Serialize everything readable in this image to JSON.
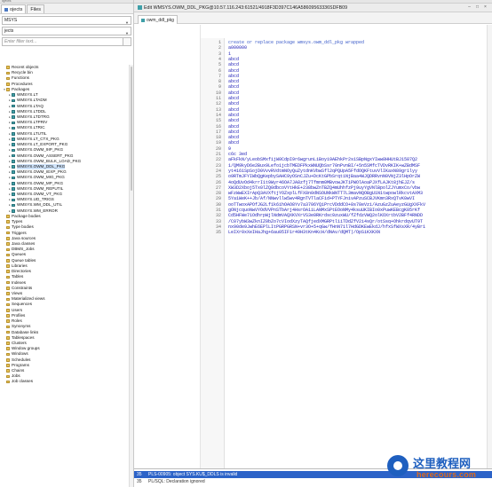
{
  "left_panel": {
    "topbar_text": "ojects",
    "tabs": [
      {
        "label": "ojects",
        "active": true
      },
      {
        "label": "Files",
        "active": false
      }
    ],
    "schema_select": "MSYS",
    "type_select": "jects",
    "filter_placeholder": "Enter filter text...",
    "tree": [
      {
        "label": "Recent objects",
        "kind": "folder",
        "expandable": false
      },
      {
        "label": "Recycle bin",
        "kind": "folder",
        "expandable": false
      },
      {
        "label": "Functions",
        "kind": "folder",
        "expandable": false
      },
      {
        "label": "Procedures",
        "kind": "folder",
        "expandable": false
      },
      {
        "label": "Packages",
        "kind": "folder",
        "expandable": true,
        "expanded": true
      },
      {
        "label": "WMSYS.LT",
        "kind": "pkg",
        "expandable": true
      },
      {
        "label": "WMSYS.LTADM",
        "kind": "pkg",
        "expandable": true
      },
      {
        "label": "WMSYS.LTAQ",
        "kind": "pkg",
        "expandable": true
      },
      {
        "label": "WMSYS.LTDDL",
        "kind": "pkg",
        "expandable": true
      },
      {
        "label": "WMSYS.LTDTRG",
        "kind": "pkg",
        "expandable": true
      },
      {
        "label": "WMSYS.LTPRIV",
        "kind": "pkg",
        "expandable": true
      },
      {
        "label": "WMSYS.LTRIC",
        "kind": "pkg",
        "expandable": true
      },
      {
        "label": "WMSYS.LTUTIL",
        "kind": "pkg",
        "expandable": true
      },
      {
        "label": "WMSYS.LT_CTX_PKG",
        "kind": "pkg",
        "expandable": true
      },
      {
        "label": "WMSYS.LT_EXPORT_PKG",
        "kind": "pkg",
        "expandable": true
      },
      {
        "label": "WMSYS.OWM_9IP_PKG",
        "kind": "pkg",
        "expandable": true
      },
      {
        "label": "WMSYS.OWM_ASSERT_PKG",
        "kind": "pkg",
        "expandable": true
      },
      {
        "label": "WMSYS.OWM_BULK_LOAD_PKG",
        "kind": "pkg",
        "expandable": true
      },
      {
        "label": "WMSYS.OWM_DDL_PKG",
        "kind": "pkg",
        "expandable": true,
        "selected": true
      },
      {
        "label": "WMSYS.OWM_IEXP_PKG",
        "kind": "pkg",
        "expandable": true
      },
      {
        "label": "WMSYS.OWM_MIG_PKG",
        "kind": "pkg",
        "expandable": true
      },
      {
        "label": "WMSYS.OWM_MP_PKG",
        "kind": "pkg",
        "expandable": true
      },
      {
        "label": "WMSYS.OWM_REPUTIL",
        "kind": "pkg",
        "expandable": true
      },
      {
        "label": "WMSYS.OWM_VT_PKG",
        "kind": "pkg",
        "expandable": true
      },
      {
        "label": "WMSYS.UD_TRIGS",
        "kind": "pkg",
        "expandable": true
      },
      {
        "label": "WMSYS.WM_DDL_UTIL",
        "kind": "pkg",
        "expandable": true
      },
      {
        "label": "WMSYS.WM_ERROR",
        "kind": "pkg",
        "expandable": true
      },
      {
        "label": "Package bodies",
        "kind": "folder",
        "expandable": false
      },
      {
        "label": "Types",
        "kind": "folder",
        "expandable": false
      },
      {
        "label": "Type bodies",
        "kind": "folder",
        "expandable": false
      },
      {
        "label": "Triggers",
        "kind": "folder",
        "expandable": false
      },
      {
        "label": "Java sources",
        "kind": "folder",
        "expandable": false
      },
      {
        "label": "Java classes",
        "kind": "folder",
        "expandable": false
      },
      {
        "label": "DBMS_Jobs",
        "kind": "folder",
        "expandable": false
      },
      {
        "label": "Queues",
        "kind": "folder",
        "expandable": false
      },
      {
        "label": "Queue tables",
        "kind": "folder",
        "expandable": false
      },
      {
        "label": "Libraries",
        "kind": "folder",
        "expandable": false
      },
      {
        "label": "Directories",
        "kind": "folder",
        "expandable": false
      },
      {
        "label": "Tables",
        "kind": "folder",
        "expandable": false
      },
      {
        "label": "Indexes",
        "kind": "folder",
        "expandable": false
      },
      {
        "label": "Constraints",
        "kind": "folder",
        "expandable": false
      },
      {
        "label": "Views",
        "kind": "folder",
        "expandable": false
      },
      {
        "label": "Materialized views",
        "kind": "folder",
        "expandable": false
      },
      {
        "label": "Sequences",
        "kind": "folder",
        "expandable": false
      },
      {
        "label": "Users",
        "kind": "folder",
        "expandable": false
      },
      {
        "label": "Profiles",
        "kind": "folder",
        "expandable": false
      },
      {
        "label": "Roles",
        "kind": "folder",
        "expandable": false
      },
      {
        "label": "Synonyms",
        "kind": "folder",
        "expandable": false
      },
      {
        "label": "Database links",
        "kind": "folder",
        "expandable": false
      },
      {
        "label": "Tablespaces",
        "kind": "folder",
        "expandable": false
      },
      {
        "label": "Clusters",
        "kind": "folder",
        "expandable": false
      },
      {
        "label": "Window groups",
        "kind": "folder",
        "expandable": false
      },
      {
        "label": "Windows",
        "kind": "folder",
        "expandable": false
      },
      {
        "label": "Schedules",
        "kind": "folder",
        "expandable": false
      },
      {
        "label": "Programs",
        "kind": "folder",
        "expandable": false
      },
      {
        "label": "Chains",
        "kind": "folder",
        "expandable": false
      },
      {
        "label": "Jobs",
        "kind": "folder",
        "expandable": false
      },
      {
        "label": "Job classes",
        "kind": "folder",
        "expandable": false
      }
    ]
  },
  "editor": {
    "window_title": "Edit WMSYS.OWM_DDL_PKG@10.57.116.243:61521/4918F3D397C146A58609563336SDFB09",
    "tab_label": "owm_ddl_pkg",
    "lines": [
      {
        "n": "1",
        "text": "create or replace package wmsys.owm_ddl_pkg wrapped"
      },
      {
        "n": "2",
        "text": "a000000"
      },
      {
        "n": "3",
        "text": "1"
      },
      {
        "n": "4",
        "text": "abcd"
      },
      {
        "n": "5",
        "text": "abcd"
      },
      {
        "n": "6",
        "text": "abcd"
      },
      {
        "n": "7",
        "text": "abcd"
      },
      {
        "n": "8",
        "text": "abcd"
      },
      {
        "n": "9",
        "text": "abcd"
      },
      {
        "n": "10",
        "text": "abcd"
      },
      {
        "n": "11",
        "text": "abcd"
      },
      {
        "n": "12",
        "text": "abcd"
      },
      {
        "n": "13",
        "text": "abcd"
      },
      {
        "n": "14",
        "text": "abcd"
      },
      {
        "n": "15",
        "text": "abcd"
      },
      {
        "n": "16",
        "text": "abcd"
      },
      {
        "n": "17",
        "text": "abcd"
      },
      {
        "n": "18",
        "text": "abcd"
      },
      {
        "n": "19",
        "text": "abcd"
      },
      {
        "n": "20",
        "text": "9"
      },
      {
        "n": "21",
        "text": "c6c 3ed"
      },
      {
        "n": "22",
        "text": "aFkFkN/yLeobSMxfijW0CdpI9r6wgrunLiBoyi9AEhkPr2s1SBpNgxYIww8HHUtBJ1587Q2"
      },
      {
        "n": "23",
        "text": "1/QM9kyD6e2Bux9Lefo1jcbTMEDFPkxWNUQbSsr70nPvnBI/+5n5SMfcTVDvRKIK+wZBdMSF"
      },
      {
        "n": "24",
        "text": "yt4161SpSojD0VvvRVdtmNOyQuZytdnKVbwSfl2qPQUpA5FfdOQKFtuvVlIKaxN89gr1lyy"
      },
      {
        "n": "25",
        "text": "o9RTmJFYIWbQgKepbySAHC9yOSnCJZu+DcKtGPbSrqtiNjBaa4WJQDRRvnN0VNjZ3lHpOrZW"
      },
      {
        "n": "26",
        "text": "4oQdUvOd4krrI1t9Wyr46OA7JA8zfj7Tfmnm0MBvowJKTiPWOlAoaPJXfLAJKt8jhEJZ/s"
      },
      {
        "n": "27",
        "text": "XW3D2Xboj5Tx0lZQ0dbcoVYtHkE+238bwZnTBZQ4mUhhfzPj9uyYgVNlBpolZJYumxCo/vbw"
      },
      {
        "n": "28",
        "text": "wFzWwEXIrApQ3AVXftjYOZxplLfFX8n0dNSOUNkWNTT7L3mavNQOBgU1N1twpowlRkcvtAXM3"
      },
      {
        "n": "29",
        "text": "5Ya1WeK++Jb/Af/NNwvllw5wv4RgnTVTlaCFid+PTYFJnivAPzuSCBJVKmn3RxQTvK0wVI"
      },
      {
        "n": "30",
        "text": "ooTTwoxAPOfJG2Lf1k6ihOAO8Yv7a3706YQiPrcVDddCO+8s78eVzi/AzuGzZuAeyzGUgXXFkV"
      },
      {
        "n": "31",
        "text": "gONjcquoNwVYOdVVPnSTbArj4HsrOA1iLANMxSPtEOoNMy4ksuUKIBIo0xPuwKEBcgK05rKf"
      },
      {
        "n": "32",
        "text": "Cd5HFWe71OdhrpWjlNdmVAQXKVXrVS3e0RKrdsc9zuxWU/fZfdzVWQ2olKOXrtbV2BFf4RNDD"
      },
      {
        "n": "33",
        "text": "/C07ybW3wZknIZ0bZo7cVIodXzyTAQfjedXMGRPtl1iTDdZfV2i4sQr/otSsq+OhkrdqvUT9T"
      },
      {
        "n": "34",
        "text": "nx90de9JwhE6EPlLItPGRPGRSN+vr3O+5+qGw/fHnN71l7HdGDKEwEkdJ/hfxSfWXsXR/4yBr1"
      },
      {
        "n": "35",
        "text": "LeIXr0xXeIHaJhg+6au05IF1r49H3tKn4KcH/dNAv/dQMT)/OpSiKXKXN"
      }
    ]
  },
  "messages": [
    {
      "line": "35",
      "text": "PLS-00905: object SYS.KU$_DDLS is invalid",
      "kind": "error"
    },
    {
      "line": "35",
      "text": "PL/SQL: Declaration ignored",
      "kind": "warning"
    }
  ],
  "watermark": {
    "cn": "这里教程网",
    "en": "herecours.com"
  },
  "colors": {
    "keyword": "#3b5bc9",
    "code_text": "#2020b8",
    "selection": "#cfe3fa",
    "error_bar": "#2c63c8",
    "watermark_blue": "#1e5fbf",
    "watermark_orange": "#e06a1b"
  }
}
